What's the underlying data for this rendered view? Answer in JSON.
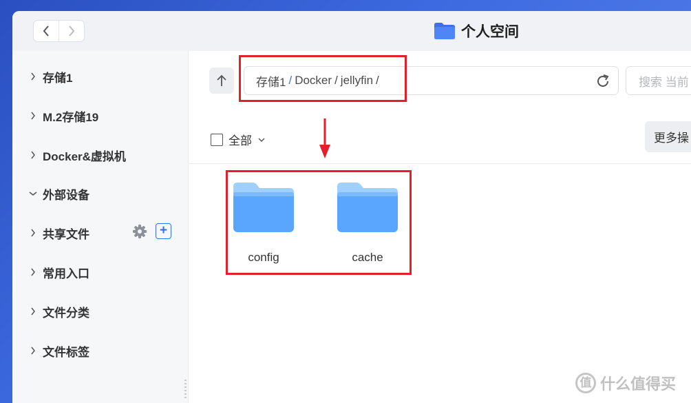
{
  "window": {
    "title": "个人空间"
  },
  "sidebar": {
    "items": [
      {
        "label": "存储1",
        "expanded": false
      },
      {
        "label": "M.2存储19",
        "expanded": false
      },
      {
        "label": "Docker&虚拟机",
        "expanded": false
      },
      {
        "label": "外部设备",
        "expanded": true
      },
      {
        "label": "共享文件",
        "expanded": false
      },
      {
        "label": "常用入口",
        "expanded": false
      },
      {
        "label": "文件分类",
        "expanded": false
      },
      {
        "label": "文件标签",
        "expanded": false
      }
    ],
    "add_symbol": "+"
  },
  "toolbar": {
    "path": [
      "存储1",
      "Docker",
      "jellyfin"
    ],
    "path_separator": "/",
    "search_placeholder": "搜索 当前",
    "select_all_label": "全部",
    "more_label": "更多操"
  },
  "files": [
    {
      "name": "config",
      "type": "folder"
    },
    {
      "name": "cache",
      "type": "folder"
    }
  ],
  "annotations": {
    "highlight_color": "#e3202a"
  },
  "watermark": {
    "text": "什么值得买",
    "mark": "值"
  },
  "colors": {
    "accent": "#3a6ee6",
    "folder": "#5aa6ff"
  }
}
